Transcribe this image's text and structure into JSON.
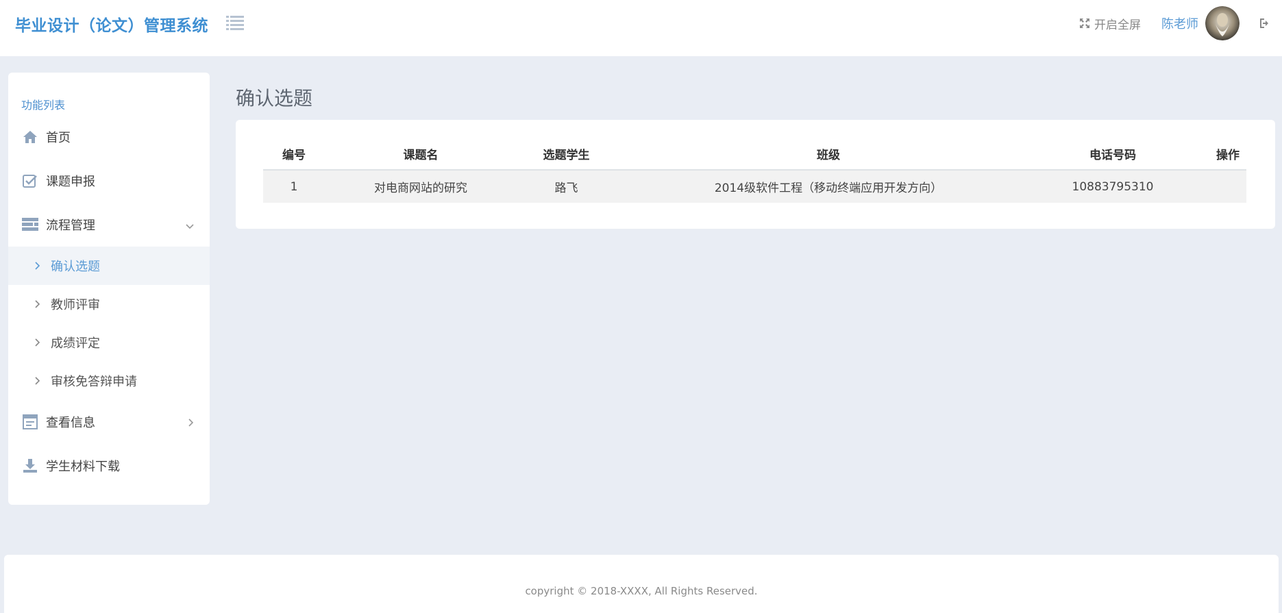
{
  "header": {
    "brand": "毕业设计（论文）管理系统",
    "fullscreen_label": "开启全屏",
    "username": "陈老师"
  },
  "sidebar": {
    "title": "功能列表",
    "items": [
      {
        "label": "首页",
        "icon": "home-icon"
      },
      {
        "label": "课题申报",
        "icon": "checkbox-icon"
      },
      {
        "label": "流程管理",
        "icon": "process-icon",
        "expanded": true,
        "children": [
          {
            "label": "确认选题",
            "active": true
          },
          {
            "label": "教师评审"
          },
          {
            "label": "成绩评定"
          },
          {
            "label": "审核免答辩申请"
          }
        ]
      },
      {
        "label": "查看信息",
        "icon": "info-icon"
      },
      {
        "label": "学生材料下载",
        "icon": "download-icon"
      }
    ]
  },
  "main": {
    "title": "确认选题",
    "table": {
      "headers": [
        "编号",
        "课题名",
        "选题学生",
        "班级",
        "电话号码",
        "操作"
      ],
      "rows": [
        [
          "1",
          "对电商网站的研究",
          "路飞",
          "2014级软件工程（移动终端应用开发方向）",
          "10883795310",
          ""
        ]
      ]
    }
  },
  "footer": {
    "copyright": "copyright © 2018-XXXX, All Rights Reserved."
  },
  "colors": {
    "accent": "#3f8fd2",
    "link": "#5b9bd5",
    "background": "#e9edf4",
    "icon": "#8fa4bd"
  }
}
